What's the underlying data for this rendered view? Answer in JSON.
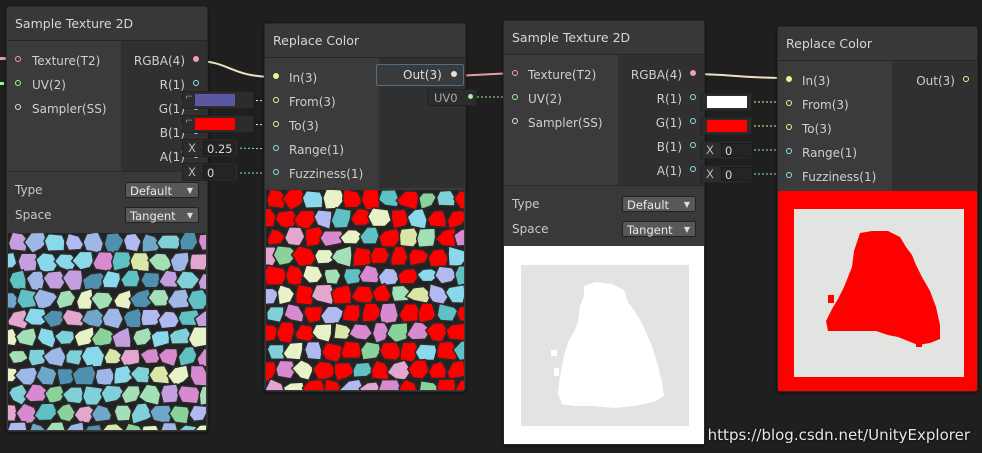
{
  "node1": {
    "title": "Sample Texture 2D",
    "inputs": [
      "Texture(T2)",
      "UV(2)",
      "Sampler(SS)"
    ],
    "outputs": [
      "RGBA(4)",
      "R(1)",
      "G(1)",
      "B(1)",
      "A(1)"
    ],
    "type_label": "Type",
    "type_value": "Default",
    "space_label": "Space",
    "space_value": "Tangent"
  },
  "node2": {
    "title": "Replace Color",
    "inputs": [
      "In(3)",
      "From(3)",
      "To(3)",
      "Range(1)",
      "Fuzziness(1)"
    ],
    "out": "Out(3)",
    "from_color": "#5a58a2",
    "to_color": "#ff0000",
    "range_x": "X",
    "range_value": "0.25",
    "fuzz_x": "X",
    "fuzz_value": "0"
  },
  "node3": {
    "title": "Sample Texture 2D",
    "inputs": [
      "Texture(T2)",
      "UV(2)",
      "Sampler(SS)"
    ],
    "outputs": [
      "RGBA(4)",
      "R(1)",
      "G(1)",
      "B(1)",
      "A(1)"
    ],
    "type_label": "Type",
    "type_value": "Default",
    "space_label": "Space",
    "space_value": "Tangent",
    "uv_chip": "UV0"
  },
  "node4": {
    "title": "Replace Color",
    "inputs": [
      "In(3)",
      "From(3)",
      "To(3)",
      "Range(1)",
      "Fuzziness(1)"
    ],
    "out": "Out(3)",
    "from_color": "#ffffff",
    "to_color": "#ff0000",
    "range_x": "X",
    "range_value": "0",
    "fuzz_x": "X",
    "fuzz_value": "0"
  },
  "watermark": "https://blog.csdn.net/UnityExplorer",
  "colors": {
    "node_bg": "#393939",
    "canvas": "#1f1f1f",
    "accent_red": "#ff0000"
  }
}
